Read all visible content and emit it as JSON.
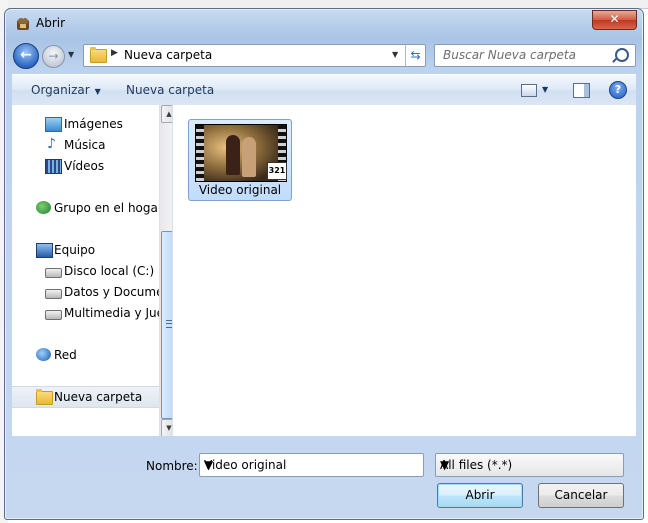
{
  "window": {
    "title": "Abrir",
    "close_label": "✕"
  },
  "address_bar": {
    "crumb": "Nueva carpeta"
  },
  "search": {
    "placeholder": "Buscar Nueva carpeta"
  },
  "toolbar": {
    "organize_label": "Organizar",
    "new_folder_label": "Nueva carpeta",
    "help_label": "?"
  },
  "nav_pane": {
    "items": [
      {
        "label": "Imágenes",
        "icon": "pictures-icon"
      },
      {
        "label": "Música",
        "icon": "music-icon"
      },
      {
        "label": "Vídeos",
        "icon": "videos-icon"
      },
      {
        "label": "Grupo en el hogar",
        "icon": "homegroup-icon"
      },
      {
        "label": "Equipo",
        "icon": "computer-icon"
      },
      {
        "label": "Disco local (C:)",
        "icon": "local-disk-icon"
      },
      {
        "label": "Datos y Documentos (D:)",
        "icon": "drive-icon"
      },
      {
        "label": "Multimedia y Juegos (E:)",
        "icon": "drive-icon"
      },
      {
        "label": "Red",
        "icon": "network-icon"
      },
      {
        "label": "Nueva carpeta",
        "icon": "folder-icon"
      }
    ]
  },
  "content": {
    "files": [
      {
        "name": "Video original",
        "badge": "321",
        "icon": "video-file-icon"
      }
    ]
  },
  "bottom": {
    "name_label": "Nombre:",
    "name_value": "Video original",
    "filter_value": "All files (*.*)",
    "open_label": "Abrir",
    "cancel_label": "Cancelar"
  }
}
